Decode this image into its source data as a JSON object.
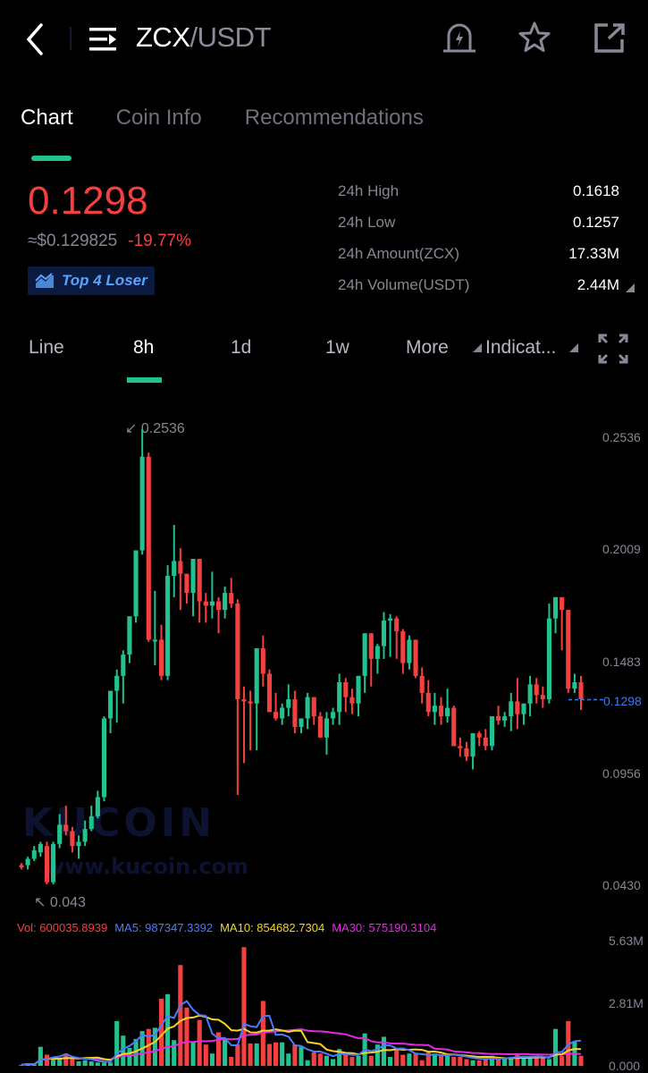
{
  "header": {
    "base": "ZCX",
    "quote": "/USDT",
    "icons": [
      "back-arrow-icon",
      "menu-list-icon",
      "price-alert-icon",
      "star-icon",
      "share-icon"
    ]
  },
  "tabs": [
    {
      "label": "Chart",
      "active": true
    },
    {
      "label": "Coin Info",
      "active": false
    },
    {
      "label": "Recommendations",
      "active": false
    }
  ],
  "ticker": {
    "last_price": "0.1298",
    "usd_value": "≈$0.129825",
    "change": "-19.77%",
    "badge": "Top 4 Loser"
  },
  "stats": [
    {
      "label": "24h High",
      "value": "0.1618"
    },
    {
      "label": "24h Low",
      "value": "0.1257"
    },
    {
      "label": "24h Amount(ZCX)",
      "value": "17.33M"
    },
    {
      "label": "24h Volume(USDT)",
      "value": "2.44M"
    }
  ],
  "intervals": {
    "line": "Line",
    "h8": "8h",
    "d1": "1d",
    "w1": "1w",
    "more": "More",
    "indicators": "Indicat..."
  },
  "colors": {
    "up": "#21c28e",
    "down": "#f4403f",
    "accent": "#21c28e",
    "ma5": "#4b7bff",
    "ma10": "#f5d328",
    "ma30": "#e229e6",
    "vol": "#f4403f",
    "last_price_line": "#3b7bf0"
  },
  "watermark": {
    "brand": "KUCOIN",
    "url": "www.kucoin.com"
  },
  "legend": {
    "vol": "Vol: 600035.8939",
    "ma5": "MA5: 987347.3392",
    "ma10": "MA10: 854682.7304",
    "ma30": "MA30: 575190.3104"
  },
  "chart_data": {
    "type": "candlestick",
    "title": "ZCX/USDT 8h",
    "price_axis": {
      "ticks": [
        "0.2536",
        "0.2009",
        "0.1483",
        "0.0956",
        "0.0430"
      ],
      "range": [
        0.043,
        0.2536
      ]
    },
    "volume_axis": {
      "ticks": [
        "5.63M",
        "2.81M",
        "0.000"
      ],
      "range": [
        0,
        5630000
      ]
    },
    "max_marker": "0.2536",
    "min_marker": "0.043",
    "last_price": "0.1298",
    "candles": [
      [
        0.052,
        0.053,
        0.05,
        0.051
      ],
      [
        0.052,
        0.056,
        0.05,
        0.055
      ],
      [
        0.055,
        0.061,
        0.054,
        0.059
      ],
      [
        0.058,
        0.063,
        0.056,
        0.062
      ],
      [
        0.061,
        0.063,
        0.043,
        0.044
      ],
      [
        0.044,
        0.063,
        0.043,
        0.062
      ],
      [
        0.062,
        0.076,
        0.06,
        0.071
      ],
      [
        0.071,
        0.08,
        0.066,
        0.068
      ],
      [
        0.068,
        0.07,
        0.058,
        0.061
      ],
      [
        0.061,
        0.066,
        0.055,
        0.063
      ],
      [
        0.063,
        0.073,
        0.061,
        0.069
      ],
      [
        0.069,
        0.08,
        0.068,
        0.075
      ],
      [
        0.075,
        0.087,
        0.074,
        0.084
      ],
      [
        0.084,
        0.122,
        0.082,
        0.121
      ],
      [
        0.121,
        0.134,
        0.114,
        0.134
      ],
      [
        0.134,
        0.144,
        0.119,
        0.141
      ],
      [
        0.141,
        0.153,
        0.128,
        0.151
      ],
      [
        0.151,
        0.168,
        0.147,
        0.169
      ],
      [
        0.169,
        0.2,
        0.166,
        0.2
      ],
      [
        0.2,
        0.257,
        0.198,
        0.244
      ],
      [
        0.244,
        0.246,
        0.157,
        0.158
      ],
      [
        0.158,
        0.181,
        0.146,
        0.158
      ],
      [
        0.158,
        0.165,
        0.139,
        0.141
      ],
      [
        0.141,
        0.193,
        0.139,
        0.188
      ],
      [
        0.188,
        0.212,
        0.178,
        0.195
      ],
      [
        0.195,
        0.201,
        0.172,
        0.189
      ],
      [
        0.189,
        0.187,
        0.175,
        0.18
      ],
      [
        0.18,
        0.192,
        0.169,
        0.196
      ],
      [
        0.196,
        0.183,
        0.166,
        0.176
      ],
      [
        0.176,
        0.18,
        0.166,
        0.174
      ],
      [
        0.174,
        0.19,
        0.168,
        0.176
      ],
      [
        0.176,
        0.178,
        0.161,
        0.172
      ],
      [
        0.172,
        0.183,
        0.168,
        0.18
      ],
      [
        0.18,
        0.187,
        0.173,
        0.175
      ],
      [
        0.175,
        0.177,
        0.085,
        0.13
      ],
      [
        0.13,
        0.136,
        0.1,
        0.129
      ],
      [
        0.129,
        0.134,
        0.106,
        0.128
      ],
      [
        0.128,
        0.151,
        0.106,
        0.154
      ],
      [
        0.154,
        0.16,
        0.136,
        0.142
      ],
      [
        0.142,
        0.144,
        0.124,
        0.124
      ],
      [
        0.124,
        0.133,
        0.12,
        0.121
      ],
      [
        0.121,
        0.128,
        0.118,
        0.126
      ],
      [
        0.126,
        0.137,
        0.122,
        0.13
      ],
      [
        0.13,
        0.134,
        0.114,
        0.117
      ],
      [
        0.117,
        0.121,
        0.114,
        0.121
      ],
      [
        0.121,
        0.133,
        0.116,
        0.131
      ],
      [
        0.131,
        0.129,
        0.118,
        0.122
      ],
      [
        0.122,
        0.124,
        0.113,
        0.112
      ],
      [
        0.112,
        0.124,
        0.104,
        0.121
      ],
      [
        0.121,
        0.126,
        0.118,
        0.124
      ],
      [
        0.124,
        0.142,
        0.118,
        0.138
      ],
      [
        0.138,
        0.14,
        0.124,
        0.131
      ],
      [
        0.131,
        0.135,
        0.123,
        0.128
      ],
      [
        0.128,
        0.141,
        0.122,
        0.141
      ],
      [
        0.141,
        0.149,
        0.133,
        0.161
      ],
      [
        0.161,
        0.15,
        0.136,
        0.149
      ],
      [
        0.149,
        0.156,
        0.142,
        0.155
      ],
      [
        0.155,
        0.171,
        0.149,
        0.167
      ],
      [
        0.167,
        0.17,
        0.15,
        0.168
      ],
      [
        0.168,
        0.169,
        0.149,
        0.162
      ],
      [
        0.162,
        0.163,
        0.142,
        0.147
      ],
      [
        0.147,
        0.16,
        0.144,
        0.158
      ],
      [
        0.158,
        0.158,
        0.14,
        0.141
      ],
      [
        0.141,
        0.145,
        0.128,
        0.133
      ],
      [
        0.133,
        0.139,
        0.122,
        0.124
      ],
      [
        0.124,
        0.133,
        0.118,
        0.127
      ],
      [
        0.127,
        0.131,
        0.118,
        0.122
      ],
      [
        0.122,
        0.135,
        0.119,
        0.126
      ],
      [
        0.126,
        0.127,
        0.109,
        0.108
      ],
      [
        0.108,
        0.112,
        0.103,
        0.107
      ],
      [
        0.107,
        0.11,
        0.101,
        0.103
      ],
      [
        0.103,
        0.111,
        0.097,
        0.114
      ],
      [
        0.114,
        0.115,
        0.108,
        0.112
      ],
      [
        0.112,
        0.116,
        0.106,
        0.108
      ],
      [
        0.108,
        0.114,
        0.106,
        0.122
      ],
      [
        0.122,
        0.127,
        0.118,
        0.12
      ],
      [
        0.12,
        0.124,
        0.117,
        0.122
      ],
      [
        0.122,
        0.133,
        0.115,
        0.129
      ],
      [
        0.129,
        0.14,
        0.116,
        0.123
      ],
      [
        0.123,
        0.127,
        0.118,
        0.128
      ],
      [
        0.128,
        0.141,
        0.122,
        0.137
      ],
      [
        0.137,
        0.14,
        0.128,
        0.132
      ],
      [
        0.132,
        0.136,
        0.126,
        0.13
      ],
      [
        0.13,
        0.175,
        0.128,
        0.168
      ],
      [
        0.168,
        0.172,
        0.161,
        0.178
      ],
      [
        0.178,
        0.172,
        0.153,
        0.172
      ],
      [
        0.172,
        0.168,
        0.133,
        0.135
      ],
      [
        0.135,
        0.142,
        0.133,
        0.138
      ],
      [
        0.138,
        0.141,
        0.125,
        0.13
      ]
    ],
    "volumes": [
      0.05,
      0.1,
      0.05,
      0.85,
      0.5,
      0.4,
      0.3,
      0.55,
      0.3,
      0.2,
      0.25,
      0.2,
      0.15,
      0.15,
      0.15,
      2.0,
      1.35,
      0.8,
      1.2,
      1.55,
      1.65,
      1.7,
      3.0,
      3.2,
      1.15,
      4.5,
      2.6,
      1.05,
      2.05,
      0.95,
      0.55,
      1.5,
      1.2,
      0.4,
      0.95,
      5.3,
      1.0,
      1.0,
      2.9,
      0.98,
      1.05,
      1.05,
      0.55,
      0.95,
      0.85,
      0.25,
      0.6,
      0.55,
      0.45,
      0.3,
      0.75,
      0.55,
      0.4,
      0.45,
      1.45,
      0.45,
      0.95,
      1.3,
      0.4,
      0.75,
      0.5,
      0.55,
      0.55,
      0.25,
      0.6,
      0.55,
      0.5,
      0.45,
      0.4,
      0.4,
      0.3,
      0.25,
      0.25,
      0.35,
      0.45,
      0.3,
      0.3,
      0.4,
      0.55,
      0.45,
      0.35,
      0.35,
      0.35,
      0.3,
      1.65,
      0.45,
      2.0,
      1.1,
      0.45,
      0.55
    ],
    "ma5": "987347.3392",
    "ma10": "854682.7304",
    "ma30": "575190.3104"
  }
}
